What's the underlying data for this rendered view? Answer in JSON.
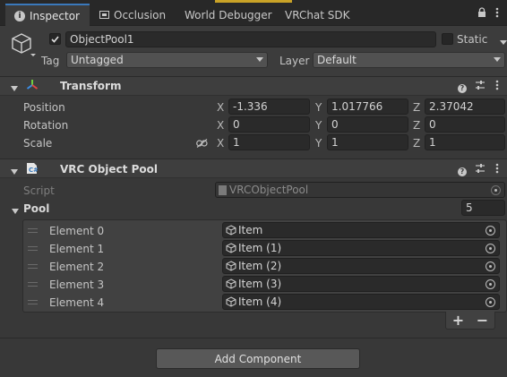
{
  "tabs": [
    {
      "label": "Inspector",
      "icon": "info-icon",
      "active": true
    },
    {
      "label": "Occlusion",
      "icon": "occlusion-icon",
      "active": false
    },
    {
      "label": "World Debugger",
      "icon": "",
      "active": false
    },
    {
      "label": "VRChat SDK",
      "icon": "",
      "active": false
    }
  ],
  "header": {
    "object_name": "ObjectPool1",
    "static_label": "Static",
    "tag_label": "Tag",
    "tag_value": "Untagged",
    "layer_label": "Layer",
    "layer_value": "Default"
  },
  "transform": {
    "title": "Transform",
    "rows": [
      {
        "label": "Position",
        "x": "-1.336",
        "y": "1.017766",
        "z": "2.37042"
      },
      {
        "label": "Rotation",
        "x": "0",
        "y": "0",
        "z": "0"
      },
      {
        "label": "Scale",
        "x": "1",
        "y": "1",
        "z": "1"
      }
    ],
    "axis_x": "X",
    "axis_y": "Y",
    "axis_z": "Z"
  },
  "vrc_pool": {
    "title": "VRC Object Pool",
    "script_label": "Script",
    "script_value": "VRCObjectPool",
    "pool_label": "Pool",
    "pool_size": "5",
    "elements": [
      {
        "label": "Element 0",
        "value": "Item"
      },
      {
        "label": "Element 1",
        "value": "Item (1)"
      },
      {
        "label": "Element 2",
        "value": "Item (2)"
      },
      {
        "label": "Element 3",
        "value": "Item (3)"
      },
      {
        "label": "Element 4",
        "value": "Item (4)"
      }
    ],
    "plus": "+",
    "minus": "−"
  },
  "add_component": "Add Component",
  "colors": {
    "accent": "#3a79bb",
    "highlight": "#c9a227",
    "background": "#383838"
  }
}
